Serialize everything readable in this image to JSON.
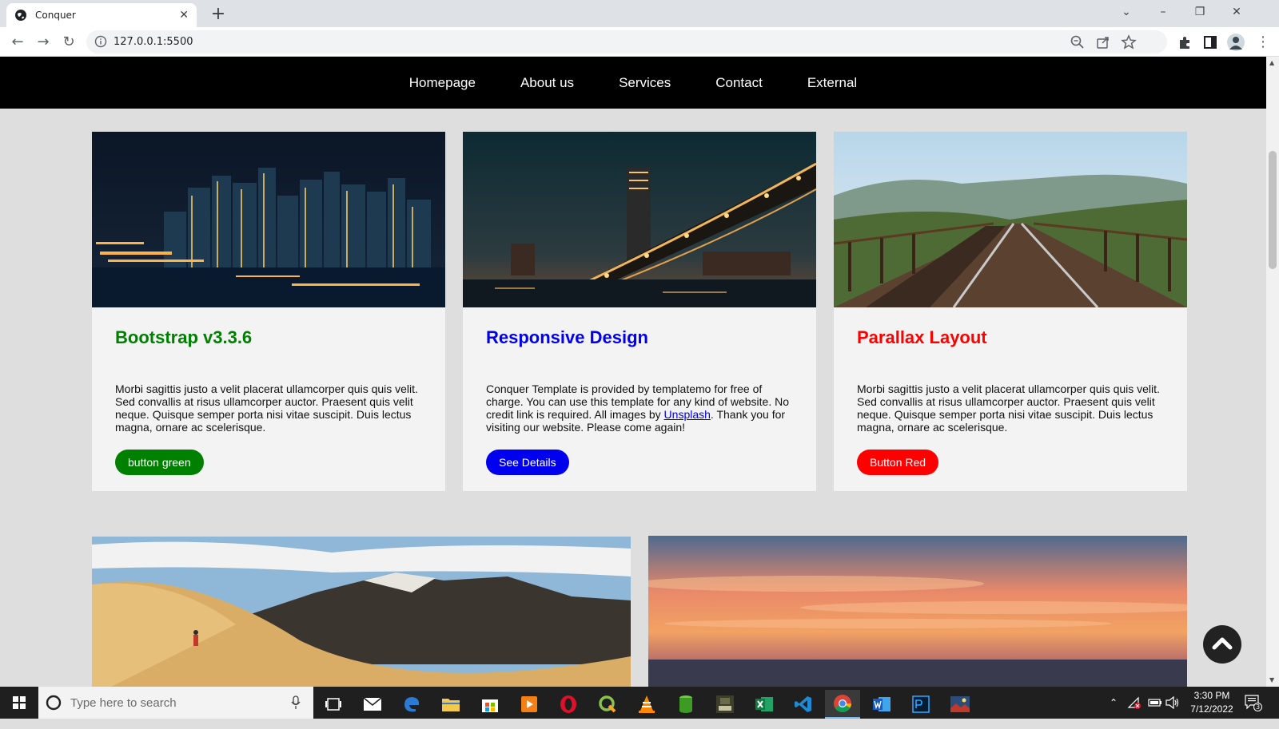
{
  "browser": {
    "tab_title": "Conquer",
    "url": "127.0.0.1:5500"
  },
  "nav": {
    "items": [
      "Homepage",
      "About us",
      "Services",
      "Contact",
      "External"
    ]
  },
  "cards": [
    {
      "title": "Bootstrap v3.3.6",
      "title_color": "#008000",
      "text": "Morbi sagittis justo a velit placerat ullamcorper quis quis velit. Sed convallis at risus ullamcorper auctor. Praesent quis velit neque. Quisque semper porta nisi vitae suscipit. Duis lectus magna, ornare ac scelerisque.",
      "button": "button green",
      "button_color": "#008000"
    },
    {
      "title": "Responsive Design",
      "title_color": "#0000ee",
      "text_before_link": "Conquer Template is provided by templatemo for free of charge. You can use this template for any kind of website. No credit link is required. All images by ",
      "link": "Unsplash",
      "text_after_link": ". Thank you for visiting our website. Please come again!",
      "button": "See Details",
      "button_color": "#0000ee"
    },
    {
      "title": "Parallax Layout",
      "title_color": "#ff0000",
      "text": "Morbi sagittis justo a velit placerat ullamcorper quis quis velit. Sed convallis at risus ullamcorper auctor. Praesent quis velit neque. Quisque semper porta nisi vitae suscipit. Duis lectus magna, ornare ac scelerisque.",
      "button": "Button Red",
      "button_color": "#ff0000"
    }
  ],
  "taskbar": {
    "search_placeholder": "Type here to search",
    "time": "3:30 PM",
    "date": "7/12/2022",
    "notification_count": "3"
  }
}
